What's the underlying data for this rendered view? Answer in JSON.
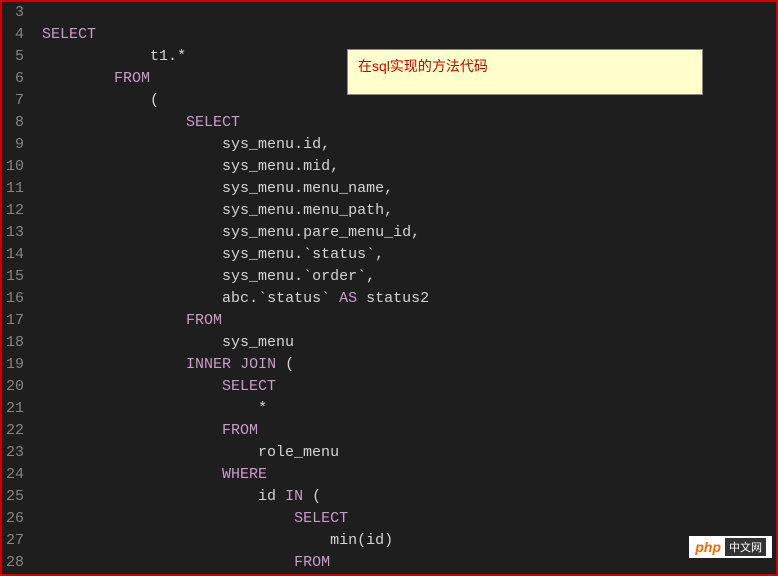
{
  "annotation": {
    "text": "在sql实现的方法代码"
  },
  "watermark": {
    "logo": "php",
    "text": "中文网"
  },
  "gutter": {
    "start": 3,
    "end": 28
  },
  "code": {
    "lines": [
      {
        "n": 3,
        "tokens": [
          {
            "t": "",
            "c": ""
          }
        ]
      },
      {
        "n": 4,
        "tokens": [
          {
            "t": "SELECT",
            "c": "keyword"
          }
        ]
      },
      {
        "n": 5,
        "tokens": [
          {
            "t": "            t1",
            "c": "identifier"
          },
          {
            "t": ".",
            "c": "punctuation"
          },
          {
            "t": "*",
            "c": "punctuation"
          }
        ]
      },
      {
        "n": 6,
        "tokens": [
          {
            "t": "        ",
            "c": ""
          },
          {
            "t": "FROM",
            "c": "keyword"
          }
        ]
      },
      {
        "n": 7,
        "tokens": [
          {
            "t": "            ",
            "c": ""
          },
          {
            "t": "(",
            "c": "punctuation"
          }
        ]
      },
      {
        "n": 8,
        "tokens": [
          {
            "t": "                ",
            "c": ""
          },
          {
            "t": "SELECT",
            "c": "keyword"
          }
        ]
      },
      {
        "n": 9,
        "tokens": [
          {
            "t": "                    sys_menu",
            "c": "identifier"
          },
          {
            "t": ".",
            "c": "punctuation"
          },
          {
            "t": "id",
            "c": "identifier"
          },
          {
            "t": ",",
            "c": "punctuation"
          }
        ]
      },
      {
        "n": 10,
        "tokens": [
          {
            "t": "                    sys_menu",
            "c": "identifier"
          },
          {
            "t": ".",
            "c": "punctuation"
          },
          {
            "t": "mid",
            "c": "identifier"
          },
          {
            "t": ",",
            "c": "punctuation"
          }
        ]
      },
      {
        "n": 11,
        "tokens": [
          {
            "t": "                    sys_menu",
            "c": "identifier"
          },
          {
            "t": ".",
            "c": "punctuation"
          },
          {
            "t": "menu_name",
            "c": "identifier"
          },
          {
            "t": ",",
            "c": "punctuation"
          }
        ]
      },
      {
        "n": 12,
        "tokens": [
          {
            "t": "                    sys_menu",
            "c": "identifier"
          },
          {
            "t": ".",
            "c": "punctuation"
          },
          {
            "t": "menu_path",
            "c": "identifier"
          },
          {
            "t": ",",
            "c": "punctuation"
          }
        ]
      },
      {
        "n": 13,
        "tokens": [
          {
            "t": "                    sys_menu",
            "c": "identifier"
          },
          {
            "t": ".",
            "c": "punctuation"
          },
          {
            "t": "pare_menu_id",
            "c": "identifier"
          },
          {
            "t": ",",
            "c": "punctuation"
          }
        ]
      },
      {
        "n": 14,
        "tokens": [
          {
            "t": "                    sys_menu",
            "c": "identifier"
          },
          {
            "t": ".",
            "c": "punctuation"
          },
          {
            "t": "`status`",
            "c": "backtick"
          },
          {
            "t": ",",
            "c": "punctuation"
          }
        ]
      },
      {
        "n": 15,
        "tokens": [
          {
            "t": "                    sys_menu",
            "c": "identifier"
          },
          {
            "t": ".",
            "c": "punctuation"
          },
          {
            "t": "`order`",
            "c": "backtick"
          },
          {
            "t": ",",
            "c": "punctuation"
          }
        ]
      },
      {
        "n": 16,
        "tokens": [
          {
            "t": "                    abc",
            "c": "identifier"
          },
          {
            "t": ".",
            "c": "punctuation"
          },
          {
            "t": "`status`",
            "c": "backtick"
          },
          {
            "t": " ",
            "c": ""
          },
          {
            "t": "AS",
            "c": "keyword"
          },
          {
            "t": " status2",
            "c": "identifier"
          }
        ]
      },
      {
        "n": 17,
        "tokens": [
          {
            "t": "                ",
            "c": ""
          },
          {
            "t": "FROM",
            "c": "keyword"
          }
        ]
      },
      {
        "n": 18,
        "tokens": [
          {
            "t": "                    sys_menu",
            "c": "identifier"
          }
        ]
      },
      {
        "n": 19,
        "tokens": [
          {
            "t": "                ",
            "c": ""
          },
          {
            "t": "INNER",
            "c": "keyword"
          },
          {
            "t": " ",
            "c": ""
          },
          {
            "t": "JOIN",
            "c": "keyword"
          },
          {
            "t": " ",
            "c": ""
          },
          {
            "t": "(",
            "c": "punctuation"
          }
        ]
      },
      {
        "n": 20,
        "tokens": [
          {
            "t": "                    ",
            "c": ""
          },
          {
            "t": "SELECT",
            "c": "keyword"
          }
        ]
      },
      {
        "n": 21,
        "tokens": [
          {
            "t": "                        ",
            "c": ""
          },
          {
            "t": "*",
            "c": "punctuation"
          }
        ]
      },
      {
        "n": 22,
        "tokens": [
          {
            "t": "                    ",
            "c": ""
          },
          {
            "t": "FROM",
            "c": "keyword"
          }
        ]
      },
      {
        "n": 23,
        "tokens": [
          {
            "t": "                        role_menu",
            "c": "identifier"
          }
        ]
      },
      {
        "n": 24,
        "tokens": [
          {
            "t": "                    ",
            "c": ""
          },
          {
            "t": "WHERE",
            "c": "keyword"
          }
        ]
      },
      {
        "n": 25,
        "tokens": [
          {
            "t": "                        id ",
            "c": "identifier"
          },
          {
            "t": "IN",
            "c": "keyword"
          },
          {
            "t": " ",
            "c": ""
          },
          {
            "t": "(",
            "c": "punctuation"
          }
        ]
      },
      {
        "n": 26,
        "tokens": [
          {
            "t": "                            ",
            "c": ""
          },
          {
            "t": "SELECT",
            "c": "keyword"
          }
        ]
      },
      {
        "n": 27,
        "tokens": [
          {
            "t": "                                ",
            "c": ""
          },
          {
            "t": "min",
            "c": "identifier"
          },
          {
            "t": "(",
            "c": "punctuation"
          },
          {
            "t": "id",
            "c": "identifier"
          },
          {
            "t": ")",
            "c": "punctuation"
          }
        ]
      },
      {
        "n": 28,
        "tokens": [
          {
            "t": "                            ",
            "c": ""
          },
          {
            "t": "FROM",
            "c": "keyword"
          }
        ]
      }
    ]
  }
}
